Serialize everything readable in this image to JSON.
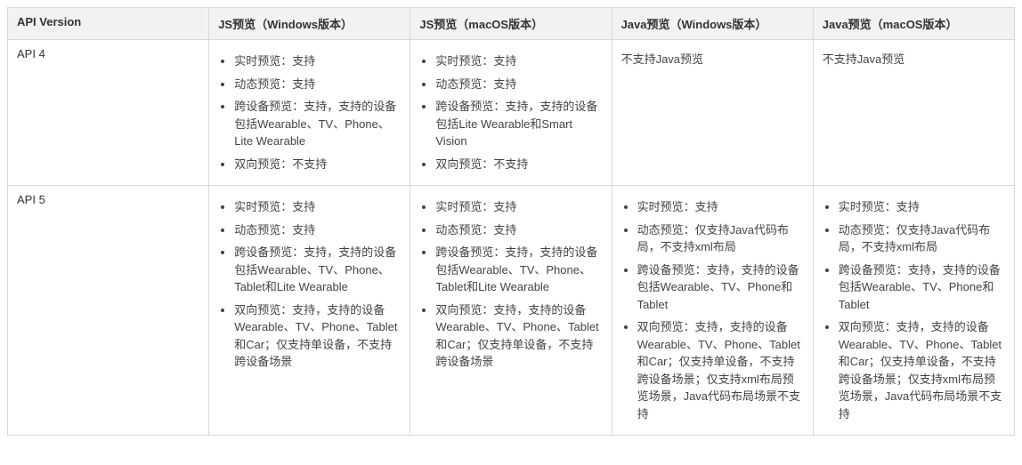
{
  "headers": [
    "API Version",
    "JS预览（Windows版本）",
    "JS预览（macOS版本）",
    "Java预览（Windows版本）",
    "Java预览（macOS版本）"
  ],
  "rows": [
    {
      "api": "API 4",
      "cells": [
        {
          "type": "list",
          "items": [
            "实时预览：支持",
            "动态预览：支持",
            "跨设备预览：支持，支持的设备包括Wearable、TV、Phone、Lite Wearable",
            "双向预览：不支持"
          ]
        },
        {
          "type": "list",
          "items": [
            "实时预览：支持",
            "动态预览：支持",
            "跨设备预览：支持，支持的设备包括Lite Wearable和Smart Vision",
            "双向预览：不支持"
          ]
        },
        {
          "type": "text",
          "value": "不支持Java预览"
        },
        {
          "type": "text",
          "value": "不支持Java预览"
        }
      ]
    },
    {
      "api": "API 5",
      "cells": [
        {
          "type": "list",
          "items": [
            "实时预览：支持",
            "动态预览：支持",
            "跨设备预览：支持，支持的设备包括Wearable、TV、Phone、Tablet和Lite Wearable",
            "双向预览：支持，支持的设备Wearable、TV、Phone、Tablet和Car；仅支持单设备，不支持跨设备场景"
          ]
        },
        {
          "type": "list",
          "items": [
            "实时预览：支持",
            "动态预览：支持",
            "跨设备预览：支持，支持的设备包括Wearable、TV、Phone、Tablet和Lite Wearable",
            "双向预览：支持，支持的设备Wearable、TV、Phone、Tablet和Car；仅支持单设备，不支持跨设备场景"
          ]
        },
        {
          "type": "list",
          "items": [
            "实时预览：支持",
            "动态预览：仅支持Java代码布局，不支持xml布局",
            "跨设备预览：支持，支持的设备包括Wearable、TV、Phone和Tablet",
            "双向预览：支持，支持的设备Wearable、TV、Phone、Tablet和Car；仅支持单设备，不支持跨设备场景；仅支持xml布局预览场景，Java代码布局场景不支持"
          ]
        },
        {
          "type": "list",
          "items": [
            "实时预览：支持",
            "动态预览：仅支持Java代码布局，不支持xml布局",
            "跨设备预览：支持，支持的设备包括Wearable、TV、Phone和Tablet",
            "双向预览：支持，支持的设备Wearable、TV、Phone、Tablet和Car；仅支持单设备，不支持跨设备场景；仅支持xml布局预览场景，Java代码布局场景不支持"
          ]
        }
      ]
    }
  ]
}
